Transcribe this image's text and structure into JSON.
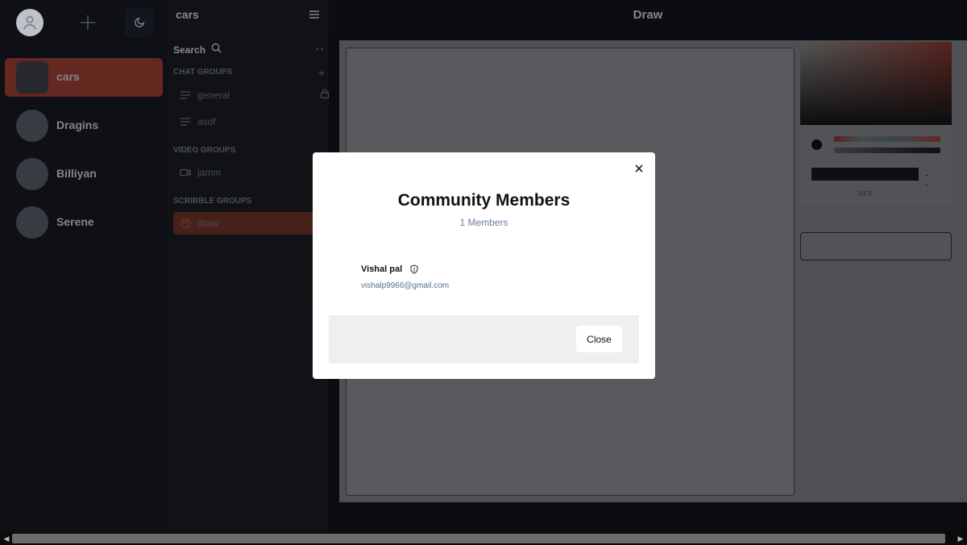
{
  "servers": [
    {
      "name": "cars",
      "active": true
    },
    {
      "name": "Dragins",
      "active": false
    },
    {
      "name": "Billiyan",
      "active": false
    },
    {
      "name": "Serene",
      "active": false
    }
  ],
  "channels_panel": {
    "title": "cars",
    "search_label": "Search",
    "sections": {
      "chat": {
        "label": "CHAT GROUPS",
        "items": [
          "general",
          "asdf"
        ]
      },
      "video": {
        "label": "VIDEO GROUPS",
        "items": [
          "jamm"
        ]
      },
      "scribble": {
        "label": "SCRIBBLE GROUPS",
        "items": [
          "draw"
        ]
      }
    }
  },
  "main": {
    "title": "Draw",
    "color_picker": {
      "hex_label": "HEX"
    }
  },
  "modal": {
    "title": "Community Members",
    "count": "1 Members",
    "members": [
      {
        "name": "Vishal pal",
        "email": "vishalp9966@gmail.com"
      }
    ],
    "close_label": "Close"
  },
  "colors": {
    "accent": "#c4442f",
    "modal_bg": "#ffffff",
    "link_text": "#5a6d94"
  }
}
